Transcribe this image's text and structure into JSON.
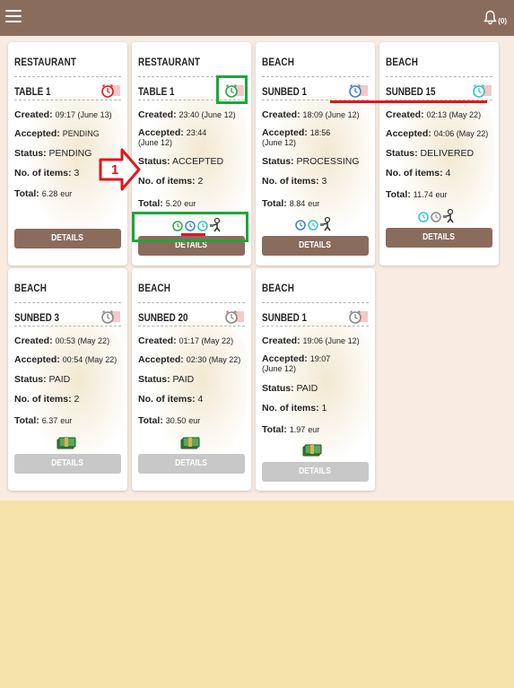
{
  "header": {
    "menu_icon": "hamburger-menu-icon",
    "bell_icon": "bell-icon",
    "notification_count": "(0)"
  },
  "labels": {
    "created": "Created:",
    "accepted": "Accepted:",
    "status": "Status:",
    "items": "No. of items:",
    "total": "Total:",
    "details": "DETAILS",
    "currency": "eur"
  },
  "orders": [
    {
      "category": "RESTAURANT",
      "table": "TABLE 1",
      "clock_color": "#e0161d",
      "created": "09:17 (June 13)",
      "accepted": "PENDING",
      "status": "PENDING",
      "items": "3",
      "total": "6.28"
    },
    {
      "category": "RESTAURANT",
      "table": "TABLE 1",
      "clock_color": "#2ea04a",
      "created": "23:40 (June 12)",
      "accepted": "23:44 (June 12)",
      "status": "ACCEPTED",
      "items": "2",
      "total": "5.20"
    },
    {
      "category": "BEACH",
      "table": "SUNBED 1",
      "clock_color": "#3a7fd6",
      "created": "18:09 (June 12)",
      "accepted": "18:56 (June 12)",
      "status": "PROCESSING",
      "items": "3",
      "total": "8.84"
    },
    {
      "category": "BEACH",
      "table": "SUNBED 15",
      "clock_color": "#2fc6c2",
      "created": "02:13 (May 22)",
      "accepted": "04:06 (May 22)",
      "status": "DELIVERED",
      "items": "4",
      "total": "11.74"
    },
    {
      "category": "BEACH",
      "table": "SUNBED 3",
      "clock_color": "#888888",
      "created": "00:53 (May 22)",
      "accepted": "00:54 (May 22)",
      "status": "PAID",
      "items": "2",
      "total": "6.37"
    },
    {
      "category": "BEACH",
      "table": "SUNBED 20",
      "clock_color": "#888888",
      "created": "01:17 (May 22)",
      "accepted": "02:30 (May 22)",
      "status": "PAID",
      "items": "4",
      "total": "30.50"
    },
    {
      "category": "BEACH",
      "table": "SUNBED 1",
      "clock_color": "#888888",
      "created": "19:06 (June 12)",
      "accepted": "19:07 (June 12)",
      "status": "PAID",
      "items": "1",
      "total": "1.97"
    }
  ],
  "annotations": {
    "step_number": "1",
    "arrow_color": "#e0161d",
    "box_color": "#1ea53a",
    "underline_color": "#e0161d"
  }
}
